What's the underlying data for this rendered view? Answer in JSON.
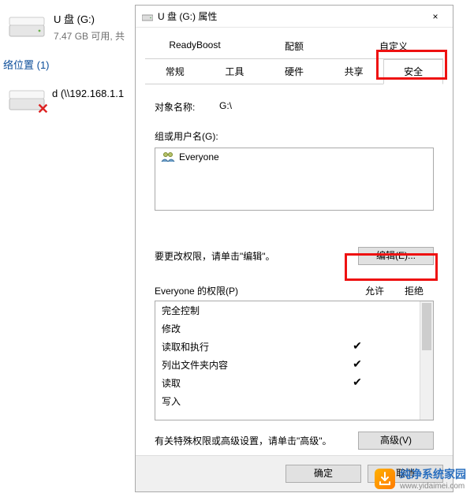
{
  "explorer": {
    "drive": {
      "name": "U 盘 (G:)",
      "sub": "7.47 GB 可用, 共"
    },
    "section": "络位置 (1)",
    "netdrive": {
      "label": "d (\\\\192.168.1.1"
    }
  },
  "dialog": {
    "title": "U 盘 (G:) 属性",
    "close": "×",
    "tabs_top": [
      "ReadyBoost",
      "配额",
      "自定义"
    ],
    "tabs_bottom": [
      "常规",
      "工具",
      "硬件",
      "共享",
      "安全"
    ],
    "object_label": "对象名称:",
    "object_value": "G:\\",
    "group_label": "组或用户名(G):",
    "users": [
      "Everyone"
    ],
    "edit_hint": "要更改权限，请单击\"编辑\"。",
    "edit_btn": "编辑(E)...",
    "perm_title": "Everyone 的权限(P)",
    "perm_allow": "允许",
    "perm_deny": "拒绝",
    "perms": [
      {
        "name": "完全控制",
        "allow": false,
        "deny": false
      },
      {
        "name": "修改",
        "allow": false,
        "deny": false
      },
      {
        "name": "读取和执行",
        "allow": true,
        "deny": false
      },
      {
        "name": "列出文件夹内容",
        "allow": true,
        "deny": false
      },
      {
        "name": "读取",
        "allow": true,
        "deny": false
      },
      {
        "name": "写入",
        "allow": false,
        "deny": false
      }
    ],
    "adv_hint": "有关特殊权限或高级设置，请单击\"高级\"。",
    "adv_btn": "高级(V)",
    "ok": "确定",
    "cancel": "取消"
  },
  "watermark": {
    "line1": "纯净系统家园",
    "line2": "www.yidaimei.com"
  }
}
